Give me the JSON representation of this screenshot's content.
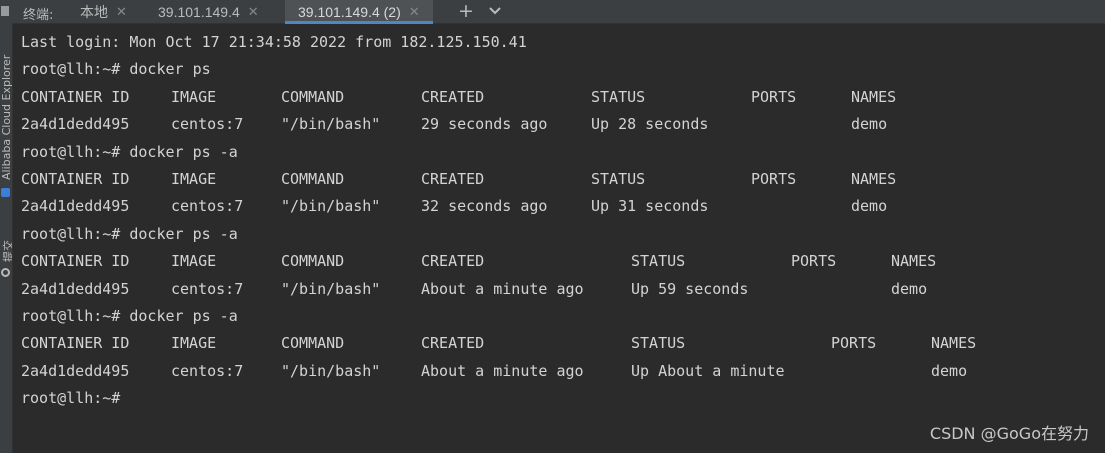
{
  "sidebar": {
    "items": [
      {
        "label": "Alibaba Cloud Explorer",
        "icon": "alibaba-cloud-icon"
      },
      {
        "label": "提交",
        "icon": "commit-icon"
      }
    ]
  },
  "tabbar": {
    "label": "终端:",
    "tabs": [
      {
        "label": "本地",
        "active": false
      },
      {
        "label": "39.101.149.4",
        "active": false
      },
      {
        "label": "39.101.149.4 (2)",
        "active": true
      }
    ],
    "new_tab_icon": "plus-icon",
    "dropdown_icon": "chevron-down-icon"
  },
  "terminal": {
    "login_line": "Last login: Mon Oct 17 21:34:58 2022 from 182.125.150.41",
    "blocks": [
      {
        "prompt": "root@llh:~# docker ps",
        "header": [
          "CONTAINER ID",
          "IMAGE",
          "COMMAND",
          "CREATED",
          "STATUS",
          "PORTS",
          "NAMES"
        ],
        "row": [
          "2a4d1dedd495",
          "centos:7",
          "\"/bin/bash\"",
          "29 seconds ago",
          "Up 28 seconds",
          "",
          "demo"
        ]
      },
      {
        "prompt": "root@llh:~# docker ps -a",
        "header": [
          "CONTAINER ID",
          "IMAGE",
          "COMMAND",
          "CREATED",
          "STATUS",
          "PORTS",
          "NAMES"
        ],
        "row": [
          "2a4d1dedd495",
          "centos:7",
          "\"/bin/bash\"",
          "32 seconds ago",
          "Up 31 seconds",
          "",
          "demo"
        ]
      },
      {
        "prompt": "root@llh:~# docker ps -a",
        "header": [
          "CONTAINER ID",
          "IMAGE",
          "COMMAND",
          "CREATED",
          "STATUS",
          "PORTS",
          "NAMES"
        ],
        "row": [
          "2a4d1dedd495",
          "centos:7",
          "\"/bin/bash\"",
          "About a minute ago",
          "Up 59 seconds",
          "",
          "demo"
        ]
      },
      {
        "prompt": "root@llh:~# docker ps -a",
        "header": [
          "CONTAINER ID",
          "IMAGE",
          "COMMAND",
          "CREATED",
          "STATUS",
          "PORTS",
          "NAMES"
        ],
        "row": [
          "2a4d1dedd495",
          "centos:7",
          "\"/bin/bash\"",
          "About a minute ago",
          "Up About a minute",
          "",
          "demo"
        ]
      }
    ],
    "final_prompt": "root@llh:~#"
  },
  "watermark": "CSDN @GoGo在努力",
  "colors": {
    "background": "#2b2b2b",
    "text": "#d3d3d3",
    "tab_active_underline": "#4a88c7",
    "tabbar": "#3c3f41"
  }
}
